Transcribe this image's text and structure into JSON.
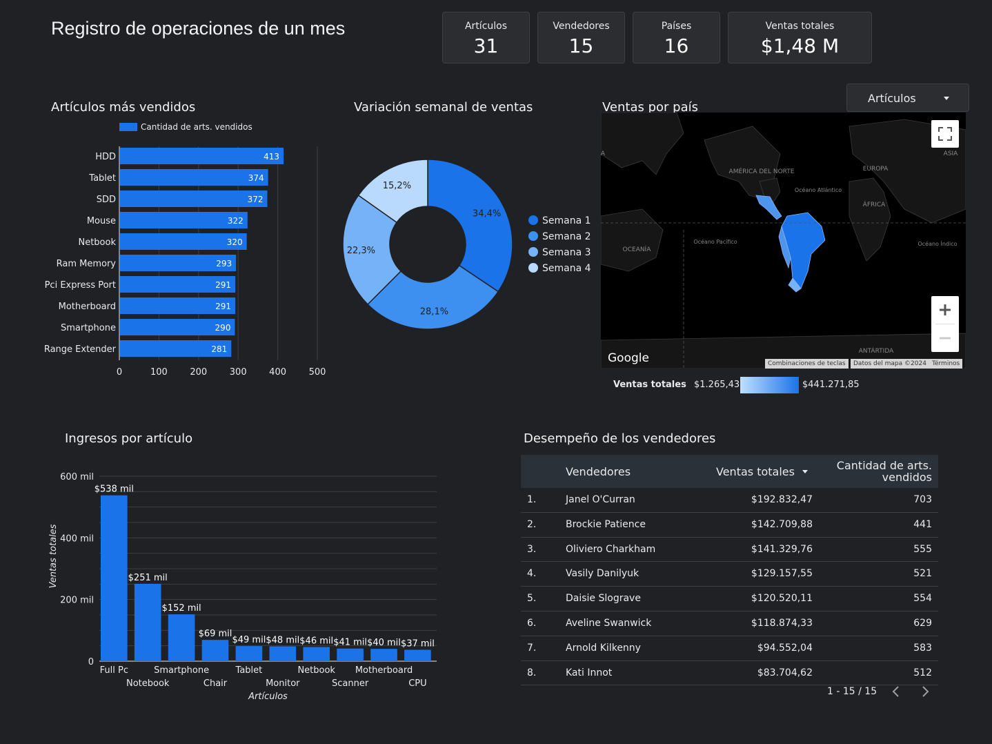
{
  "title": "Registro de operaciones de un mes",
  "kpis": [
    {
      "label": "Artículos",
      "value": "31"
    },
    {
      "label": "Vendedores",
      "value": "15"
    },
    {
      "label": "Países",
      "value": "16"
    },
    {
      "label": "Ventas totales",
      "value": "$1,48 M"
    }
  ],
  "dropdown": {
    "label": "Artículos"
  },
  "colors": {
    "primary": "#1a73e8",
    "bg": "#202124",
    "panel": "#2b2d31"
  },
  "sections": {
    "top_articles": "Artículos más vendidos",
    "weekly": "Variación semanal de ventas",
    "country": "Ventas por país",
    "revenue": "Ingresos por artículo",
    "sellers": "Desempeño de los vendedores"
  },
  "chart_data": [
    {
      "type": "bar",
      "orientation": "horizontal",
      "legend": "Cantidad de arts. vendidos",
      "categories": [
        "HDD",
        "Tablet",
        "SDD",
        "Mouse",
        "Netbook",
        "Ram Memory",
        "Pci Express Port",
        "Motherboard",
        "Smartphone",
        "Range Extender"
      ],
      "values": [
        413,
        374,
        372,
        322,
        320,
        293,
        291,
        291,
        290,
        281
      ],
      "xticks": [
        "0",
        "100",
        "200",
        "300",
        "400",
        "500"
      ],
      "xlim": [
        0,
        500
      ]
    },
    {
      "type": "pie",
      "donut": true,
      "labels": [
        "Semana 1",
        "Semana 2",
        "Semana 3",
        "Semana 4"
      ],
      "values": [
        34.4,
        28.1,
        22.3,
        15.2
      ],
      "value_labels": [
        "34,4%",
        "28,1%",
        "22,3%",
        "15,2%"
      ],
      "colors": [
        "#1a73e8",
        "#3d8ff0",
        "#75b2f7",
        "#b9d9fd"
      ]
    },
    {
      "type": "bar",
      "categories": [
        "Full Pc",
        "Notebook",
        "Smartphone",
        "Chair",
        "Tablet",
        "Monitor",
        "Netbook",
        "Scanner",
        "Motherboard",
        "CPU"
      ],
      "values": [
        538,
        251,
        152,
        69,
        49,
        48,
        46,
        41,
        40,
        37
      ],
      "value_labels": [
        "$538 mil",
        "$251 mil",
        "$152 mil",
        "$69 mil",
        "$49 mil",
        "$48 mil",
        "$46 mil",
        "$41 mil",
        "$40 mil",
        "$37 mil"
      ],
      "xlabel": "Artículos",
      "ylabel": "Ventas totales",
      "yticks": [
        "0",
        "200 mil",
        "400 mil",
        "600 mil"
      ],
      "ylim": [
        0,
        600
      ]
    }
  ],
  "map": {
    "labels": {
      "asia": "ASIA",
      "north_america": "AMÉRICA\nDEL NORTE",
      "europe": "EUROPA",
      "atlantic": "Océano\nAtlántico",
      "africa": "ÁFRICA",
      "oceania": "OCEANÍA",
      "pacific": "Océano\nPacífico",
      "indian": "Océano\nÍndico",
      "antarctica": "ANTÁRTIDA",
      "edge": "A"
    },
    "google": "Google",
    "footer": [
      "Combinaciones de teclas",
      "Datos del mapa ©2024",
      "Términos"
    ],
    "legend_title": "Ventas totales",
    "legend_min": "$1.265,43",
    "legend_max": "$441.271,85"
  },
  "table": {
    "headers": [
      "Vendedores",
      "Ventas totales",
      "Cantidad de arts.",
      "vendidos"
    ],
    "rows": [
      [
        "1.",
        "Janel O'Curran",
        "$192.832,47",
        "703"
      ],
      [
        "2.",
        "Brockie Patience",
        "$142.709,88",
        "441"
      ],
      [
        "3.",
        "Oliviero Charkham",
        "$141.329,76",
        "555"
      ],
      [
        "4.",
        "Vasily Danilyuk",
        "$129.157,55",
        "521"
      ],
      [
        "5.",
        "Daisie Slograve",
        "$120.520,11",
        "554"
      ],
      [
        "6.",
        "Aveline Swanwick",
        "$118.874,33",
        "629"
      ],
      [
        "7.",
        "Arnold Kilkenny",
        "$94.552,04",
        "583"
      ],
      [
        "8.",
        "Kati Innot",
        "$83.704,62",
        "512"
      ]
    ],
    "pagination": "1 - 15 / 15"
  }
}
